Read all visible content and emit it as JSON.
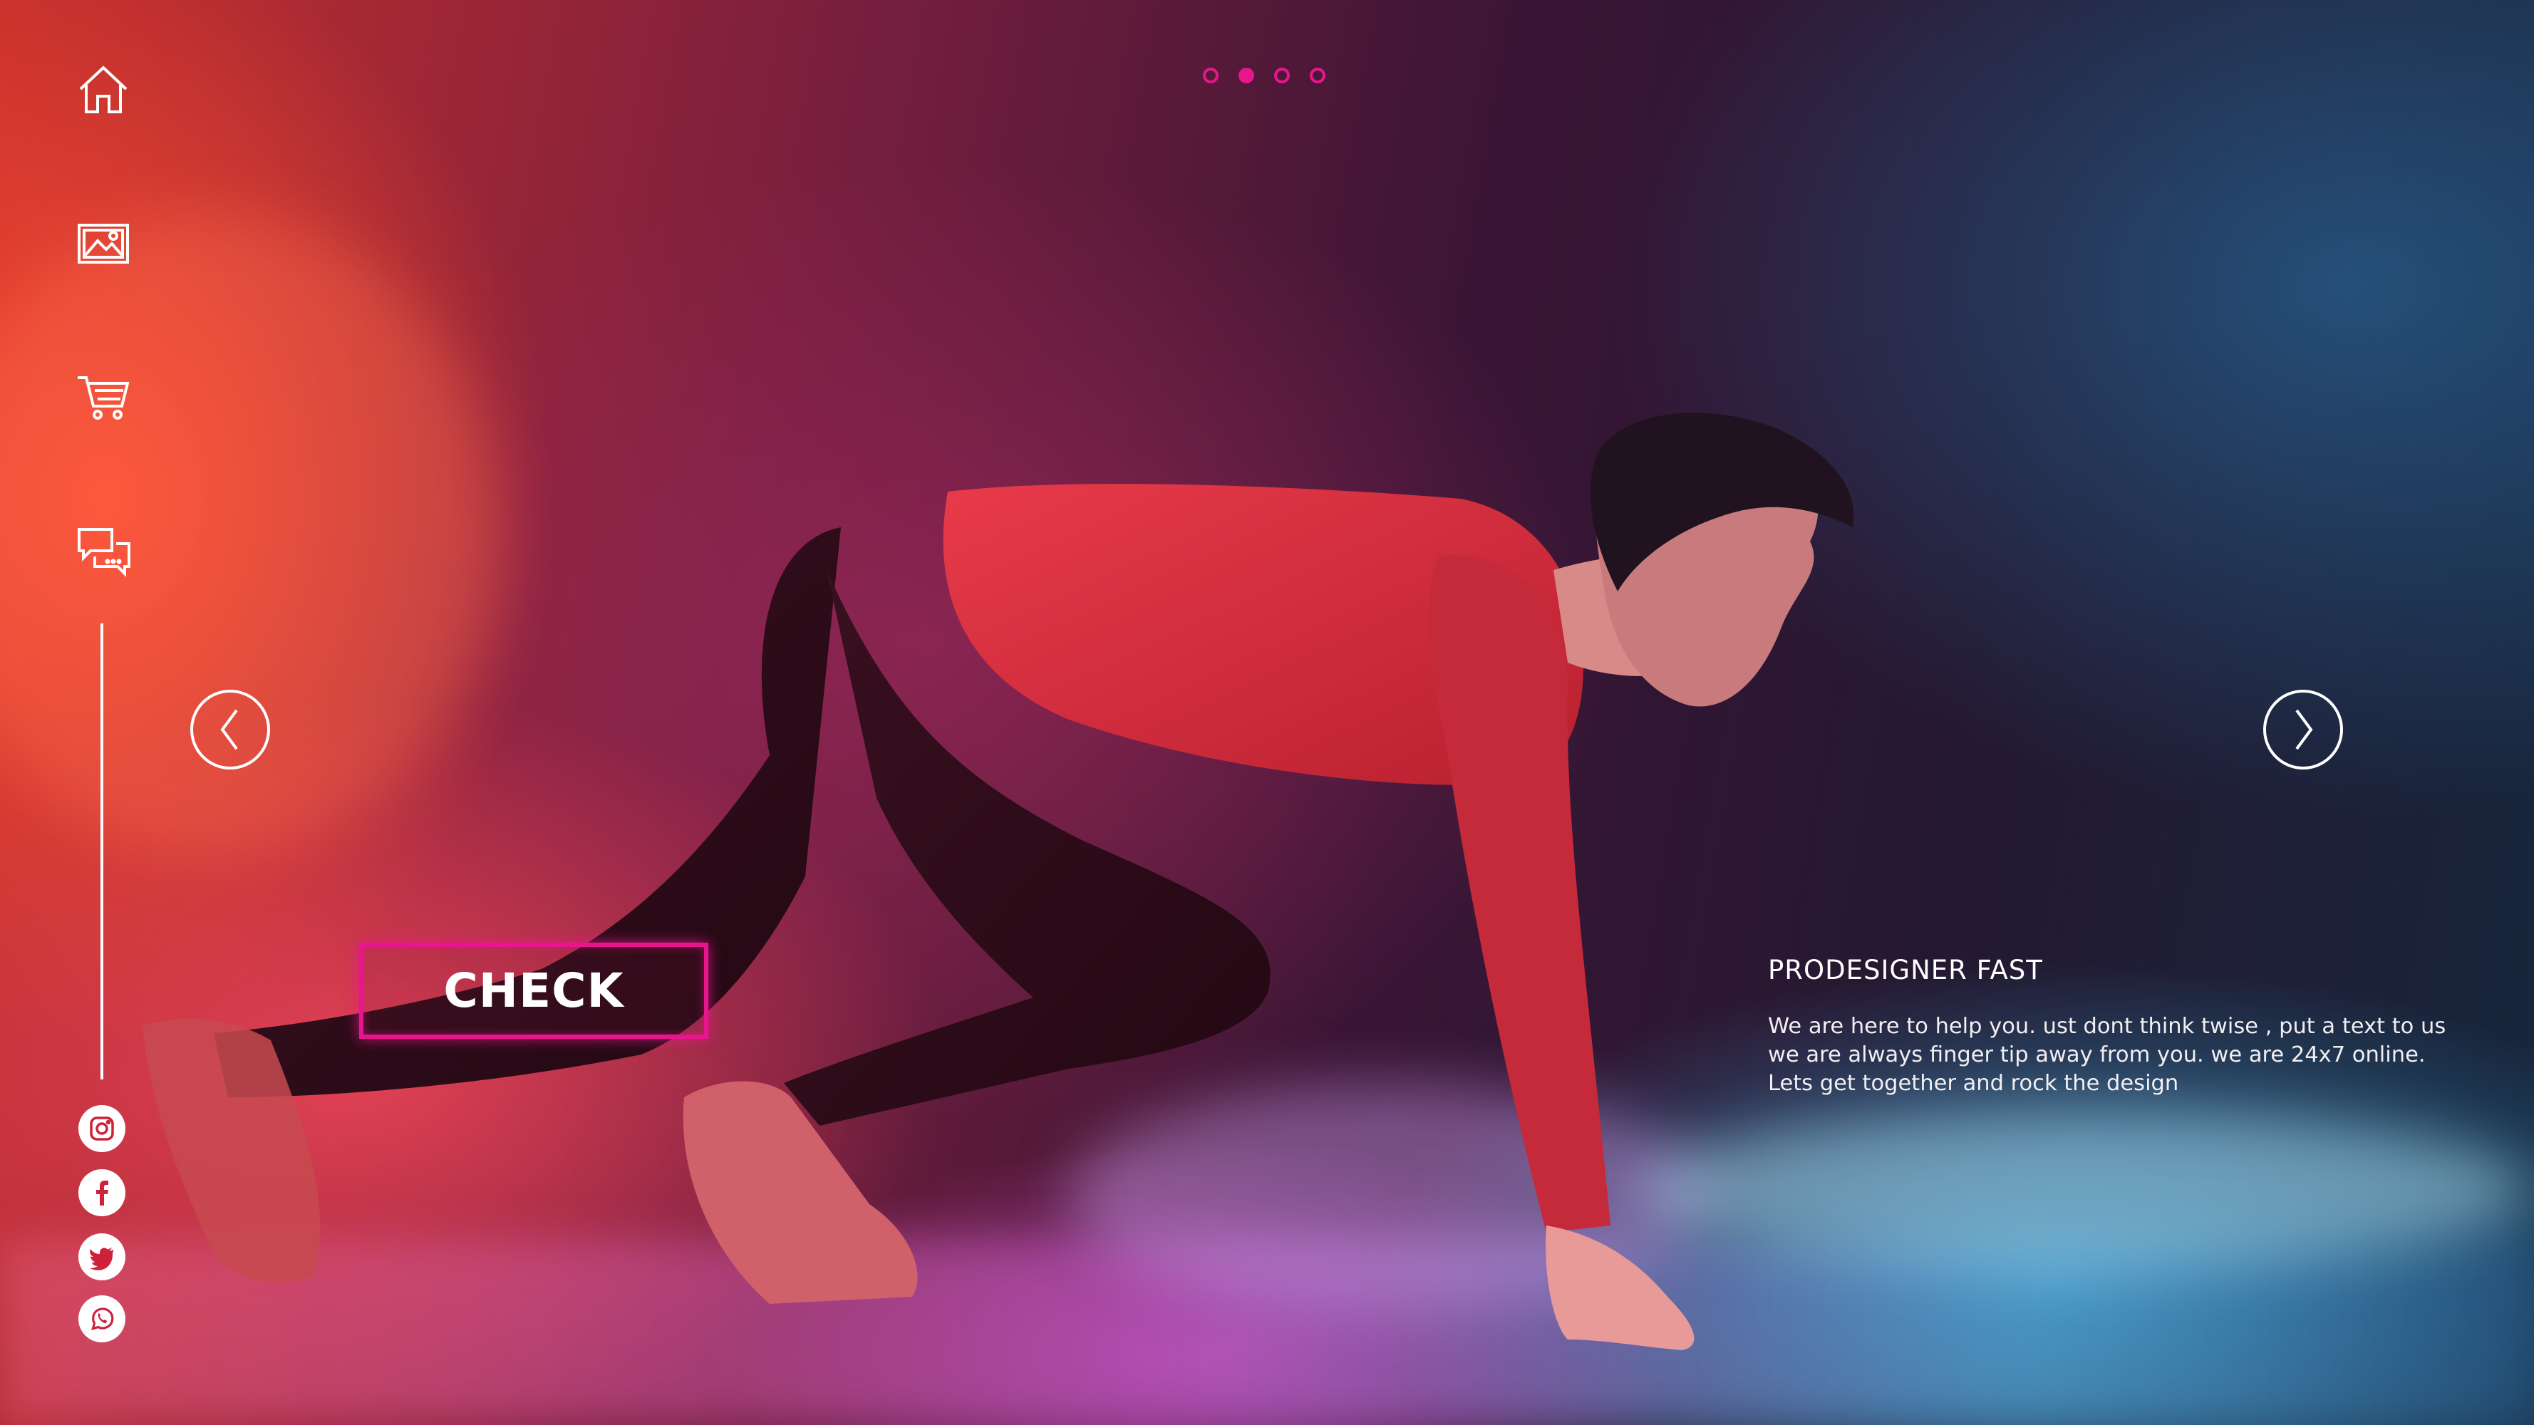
{
  "nav": {
    "items": [
      {
        "name": "home-icon"
      },
      {
        "name": "gallery-icon"
      },
      {
        "name": "cart-icon"
      },
      {
        "name": "chat-icon"
      }
    ]
  },
  "social": [
    {
      "name": "instagram-icon"
    },
    {
      "name": "facebook-icon"
    },
    {
      "name": "twitter-icon"
    },
    {
      "name": "whatsapp-icon"
    }
  ],
  "carousel": {
    "total_slides": 4,
    "active_slide": 2,
    "prev_icon": "chevron-left-icon",
    "next_icon": "chevron-right-icon"
  },
  "hero": {
    "cta_label": "CHECK",
    "title": "PRODESIGNER FAST",
    "body_lines": [
      "We are here to help you. ust dont think twise , put a text to us",
      "we are always finger tip away from you. we are 24x7 online.",
      "Lets get together and rock the design"
    ]
  },
  "colors": {
    "accent": "#e8168c",
    "icon": "#ffffff"
  }
}
